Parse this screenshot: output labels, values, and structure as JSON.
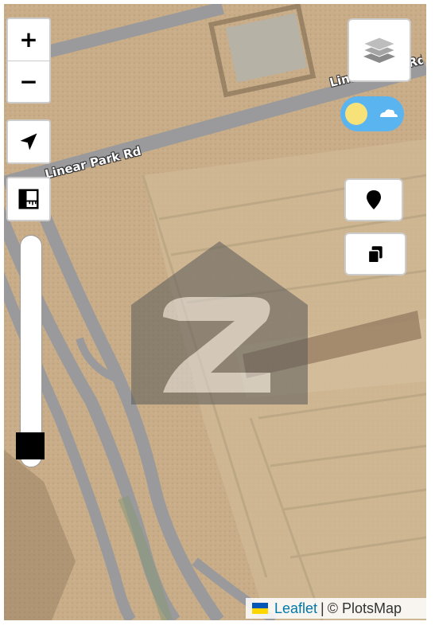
{
  "map": {
    "road_name_1": "Linear Park Rd",
    "road_name_2": "Linear Park Rd"
  },
  "controls": {
    "zoom_in_label": "+",
    "zoom_out_label": "−",
    "zoom_level_fraction": 0.05
  },
  "attribution": {
    "leaflet_label": "Leaflet",
    "separator": "|",
    "copyright": "© PlotsMap"
  },
  "icons": {
    "layers": "layers-icon",
    "locate": "navigation-arrow-icon",
    "measure": "ruler-icon",
    "marker": "map-pin-icon",
    "copy": "copy-icon",
    "theme": "sun-cloud-toggle-icon",
    "watermark": "zameen-logo-watermark"
  },
  "colors": {
    "terrain": "#c9b08c",
    "road": "#9a9a9c",
    "link": "#0078a8",
    "toggle": "#5ab4f0",
    "sun": "#f7e27a"
  }
}
